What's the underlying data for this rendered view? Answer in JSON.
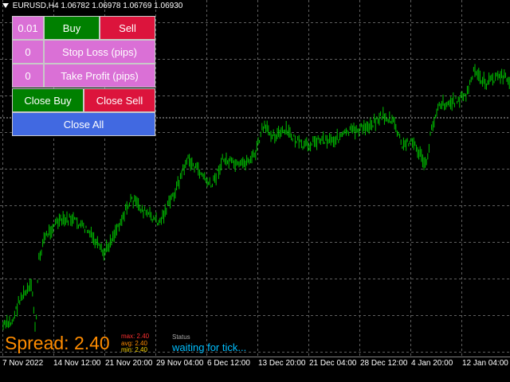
{
  "header": {
    "symbol": "EURUSD,H4",
    "open": "1.06782",
    "high": "1.06978",
    "low": "1.06769",
    "close": "1.06930"
  },
  "panel": {
    "lot": "0.01",
    "buy_label": "Buy",
    "sell_label": "Sell",
    "stop_loss_value": "0",
    "stop_loss_label": "Stop Loss (pips)",
    "take_profit_value": "0",
    "take_profit_label": "Take Profit (pips)",
    "close_buy_label": "Close Buy",
    "close_sell_label": "Close Sell",
    "close_all_label": "Close All"
  },
  "xaxis": [
    "7 Nov 2022",
    "14 Nov 12:00",
    "21 Nov 20:00",
    "29 Nov 04:00",
    "6 Dec 12:00",
    "13 Dec 20:00",
    "21 Dec 04:00",
    "28 Dec 12:00",
    "4 Jan 20:00",
    "12 Jan 04:00"
  ],
  "spread": {
    "text": "Spread: 2.40",
    "max": "max:  2.40",
    "avg": "avg:  2.40",
    "min": "min:  2.40"
  },
  "status": {
    "label": "Status",
    "text": "waiting for tick..."
  },
  "colors": {
    "background": "#000000",
    "candles": "#00c000",
    "grid": "#5f5f5f",
    "magenta_button": "#da70d6",
    "buy_button": "#008000",
    "sell_button": "#dc143c",
    "close_all_button": "#4169e1",
    "spread": "#ff8c00",
    "status_text": "#00bfff"
  }
}
